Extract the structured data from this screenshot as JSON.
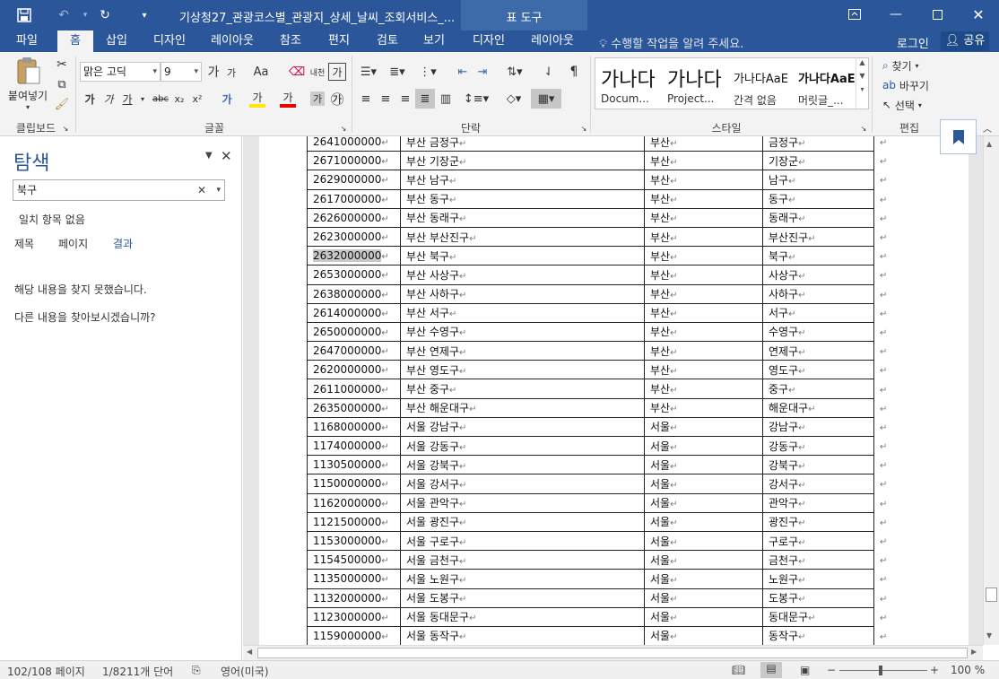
{
  "title_bar": {
    "doc_title": "기상청27_관광코스별_관광지_상세_날씨_조회서비스_...",
    "tool_context": "표 도구"
  },
  "tabs": [
    {
      "label": "파일"
    },
    {
      "label": "홈"
    },
    {
      "label": "삽입"
    },
    {
      "label": "디자인"
    },
    {
      "label": "레이아웃"
    },
    {
      "label": "참조"
    },
    {
      "label": "편지"
    },
    {
      "label": "검토"
    },
    {
      "label": "보기"
    },
    {
      "label": "디자인"
    },
    {
      "label": "레이아웃"
    }
  ],
  "active_tab": "홈",
  "tell_me": "수행할 작업을 알려 주세요.",
  "login": "로그인",
  "share": "공유",
  "ribbon": {
    "clipboard": {
      "paste": "붙여넣기",
      "label": "클립보드"
    },
    "font": {
      "name": "맑은 고딕",
      "size": "9",
      "label": "글꼴",
      "aa": "Aa",
      "pron": "내천",
      "bold": "가",
      "italic": "가",
      "underline": "가",
      "strike": "abc",
      "sub": "x₂",
      "sup": "x²",
      "charbox": "가",
      "circle": "㉮",
      "effects": "가",
      "highlight": "가",
      "fontcolor": "가",
      "shade": "가",
      "grow": "가",
      "shrink": "가"
    },
    "paragraph": {
      "label": "단락"
    },
    "styles": {
      "label": "스타일",
      "items": [
        {
          "preview": "가나다",
          "name": "Docum..."
        },
        {
          "preview": "가나다",
          "name": "Project..."
        },
        {
          "preview": "가나다AaE",
          "name": "간격 없음"
        },
        {
          "preview": "가나다AaE",
          "name": "머릿글_..."
        }
      ]
    },
    "editing": {
      "find": "찾기",
      "replace": "바꾸기",
      "select": "선택",
      "label": "편집"
    }
  },
  "nav": {
    "title": "탐색",
    "search_value": "북구",
    "no_match": "일치 항목 없음",
    "subtabs": [
      "제목",
      "페이지",
      "결과"
    ],
    "msg1": "해당 내용을 찾지 못했습니다.",
    "msg2": "다른 내용을 찾아보시겠습니까?"
  },
  "table_rows": [
    [
      "2641000000",
      "부산 금정구",
      "부산",
      "금정구"
    ],
    [
      "2671000000",
      "부산 기장군",
      "부산",
      "기장군"
    ],
    [
      "2629000000",
      "부산 남구",
      "부산",
      "남구"
    ],
    [
      "2617000000",
      "부산 동구",
      "부산",
      "동구"
    ],
    [
      "2626000000",
      "부산 동래구",
      "부산",
      "동래구"
    ],
    [
      "2623000000",
      "부산 부산진구",
      "부산",
      "부산진구"
    ],
    [
      "2632000000",
      "부산 북구",
      "부산",
      "북구"
    ],
    [
      "2653000000",
      "부산 사상구",
      "부산",
      "사상구"
    ],
    [
      "2638000000",
      "부산 사하구",
      "부산",
      "사하구"
    ],
    [
      "2614000000",
      "부산 서구",
      "부산",
      "서구"
    ],
    [
      "2650000000",
      "부산 수영구",
      "부산",
      "수영구"
    ],
    [
      "2647000000",
      "부산 연제구",
      "부산",
      "연제구"
    ],
    [
      "2620000000",
      "부산 영도구",
      "부산",
      "영도구"
    ],
    [
      "2611000000",
      "부산 중구",
      "부산",
      "중구"
    ],
    [
      "2635000000",
      "부산 해운대구",
      "부산",
      "해운대구"
    ],
    [
      "1168000000",
      "서울 강남구",
      "서울",
      "강남구"
    ],
    [
      "1174000000",
      "서울 강동구",
      "서울",
      "강동구"
    ],
    [
      "1130500000",
      "서울 강북구",
      "서울",
      "강북구"
    ],
    [
      "1150000000",
      "서울 강서구",
      "서울",
      "강서구"
    ],
    [
      "1162000000",
      "서울 관악구",
      "서울",
      "관악구"
    ],
    [
      "1121500000",
      "서울 광진구",
      "서울",
      "광진구"
    ],
    [
      "1153000000",
      "서울 구로구",
      "서울",
      "구로구"
    ],
    [
      "1154500000",
      "서울 금천구",
      "서울",
      "금천구"
    ],
    [
      "1135000000",
      "서울 노원구",
      "서울",
      "노원구"
    ],
    [
      "1132000000",
      "서울 도봉구",
      "서울",
      "도봉구"
    ],
    [
      "1123000000",
      "서울 동대문구",
      "서울",
      "동대문구"
    ],
    [
      "1159000000",
      "서울 동작구",
      "서울",
      "동작구"
    ]
  ],
  "para_mark": "↵",
  "status": {
    "page": "102/108 페이지",
    "words": "1/8211개 단어",
    "lang": "영어(미국)",
    "zoom": "100 %"
  },
  "colors": {
    "accent": "#2b579a",
    "highlight": "#c8c8c8"
  }
}
